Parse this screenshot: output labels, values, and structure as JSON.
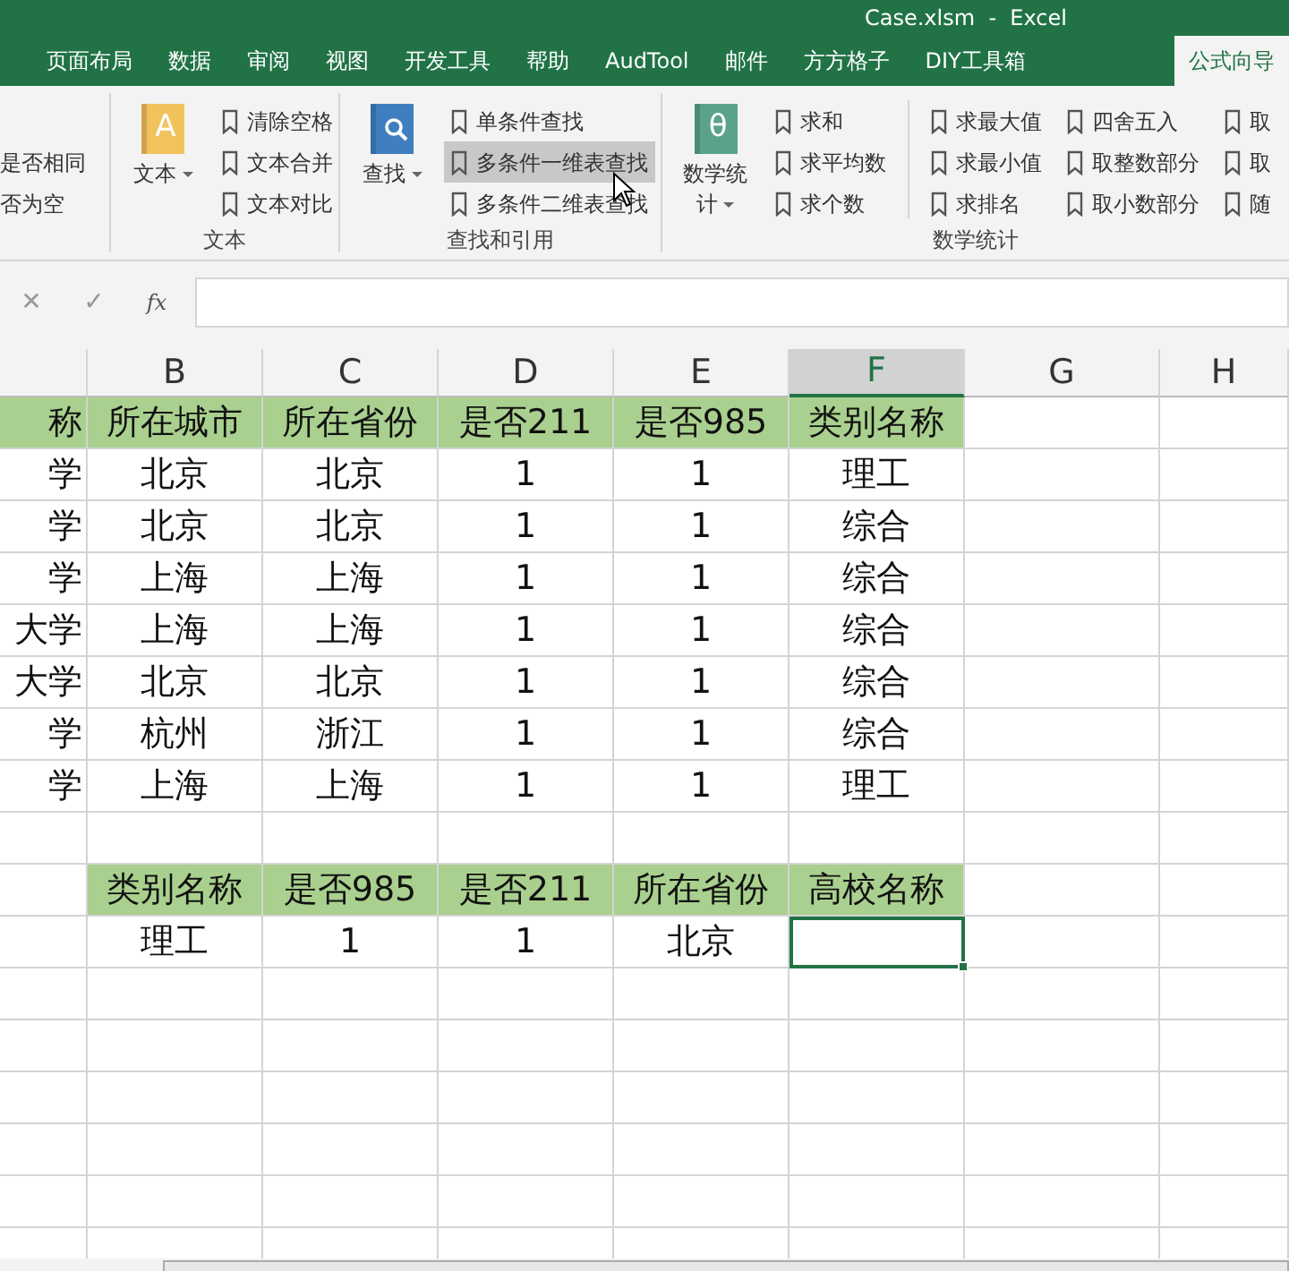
{
  "window": {
    "title": "Case.xlsm  -  Excel"
  },
  "tabs": [
    {
      "label": "页面布局",
      "selected": false
    },
    {
      "label": "数据",
      "selected": false
    },
    {
      "label": "审阅",
      "selected": false
    },
    {
      "label": "视图",
      "selected": false
    },
    {
      "label": "开发工具",
      "selected": false
    },
    {
      "label": "帮助",
      "selected": false
    },
    {
      "label": "AudTool",
      "selected": false
    },
    {
      "label": "邮件",
      "selected": false
    },
    {
      "label": "方方格子",
      "selected": false
    },
    {
      "label": "DIY工具箱",
      "selected": false
    },
    {
      "label": "公式向导",
      "selected": true
    }
  ],
  "ribbon": {
    "groups": [
      {
        "columns": [
          {
            "kind": "plain",
            "items": [
              {
                "label": "是否相同",
                "highlighted": false
              },
              {
                "label": "否为空",
                "highlighted": false
              }
            ]
          }
        ]
      },
      {
        "label": "文本",
        "big_button": {
          "kind": "letter",
          "glyph": "A",
          "label": "文本"
        },
        "columns": [
          {
            "kind": "bookmark",
            "items": [
              {
                "label": "清除空格",
                "highlighted": false
              },
              {
                "label": "文本合并",
                "highlighted": false
              },
              {
                "label": "文本对比",
                "highlighted": false
              }
            ]
          }
        ]
      },
      {
        "label": "查找和引用",
        "big_button": {
          "kind": "search",
          "label": "查找"
        },
        "columns": [
          {
            "kind": "bookmark",
            "items": [
              {
                "label": "单条件查找",
                "highlighted": false
              },
              {
                "label": "多条件一维表查找",
                "highlighted": true
              },
              {
                "label": "多条件二维表查找",
                "highlighted": false
              }
            ]
          }
        ]
      },
      {
        "label": "数学统计",
        "big_button": {
          "kind": "letter",
          "glyph": "θ",
          "label": "数学统计"
        },
        "columns": [
          {
            "kind": "bookmark",
            "items": [
              {
                "label": "求和",
                "highlighted": false
              },
              {
                "label": "求平均数",
                "highlighted": false
              },
              {
                "label": "求个数",
                "highlighted": false
              }
            ]
          },
          {
            "kind": "separator"
          },
          {
            "kind": "bookmark",
            "items": [
              {
                "label": "求最大值",
                "highlighted": false
              },
              {
                "label": "求最小值",
                "highlighted": false
              },
              {
                "label": "求排名",
                "highlighted": false
              }
            ]
          },
          {
            "kind": "bookmark",
            "items": [
              {
                "label": "四舍五入",
                "highlighted": false
              },
              {
                "label": "取整数部分",
                "highlighted": false
              },
              {
                "label": "取小数部分",
                "highlighted": false
              }
            ]
          },
          {
            "kind": "bookmark",
            "items": [
              {
                "label": "取",
                "highlighted": false
              },
              {
                "label": "取",
                "highlighted": false
              },
              {
                "label": "随",
                "highlighted": false
              }
            ]
          }
        ]
      }
    ]
  },
  "formula_bar": {
    "cancel": "✕",
    "enter": "✓",
    "function_label": "fx"
  },
  "sheet": {
    "columns": [
      null,
      {
        "label": "B",
        "selected": false
      },
      {
        "label": "C",
        "selected": false
      },
      {
        "label": "D",
        "selected": false
      },
      {
        "label": "E",
        "selected": false
      },
      {
        "label": "F",
        "selected": true
      },
      {
        "label": "G",
        "selected": false
      },
      {
        "label": "H",
        "selected": false
      }
    ],
    "rows": [
      {
        "kind": "header",
        "cells": [
          {
            "text": "称"
          },
          {
            "text": "所在城市"
          },
          {
            "text": "所在省份"
          },
          {
            "text": "是否211"
          },
          {
            "text": "是否985"
          },
          {
            "text": "类别名称"
          },
          null,
          null
        ]
      },
      {
        "kind": "data",
        "cells": [
          {
            "text": "学"
          },
          {
            "text": "北京"
          },
          {
            "text": "北京"
          },
          {
            "text": "1"
          },
          {
            "text": "1"
          },
          {
            "text": "理工"
          },
          null,
          null
        ]
      },
      {
        "kind": "data",
        "cells": [
          {
            "text": "学"
          },
          {
            "text": "北京"
          },
          {
            "text": "北京"
          },
          {
            "text": "1"
          },
          {
            "text": "1"
          },
          {
            "text": "综合"
          },
          null,
          null
        ]
      },
      {
        "kind": "data",
        "cells": [
          {
            "text": "学"
          },
          {
            "text": "上海"
          },
          {
            "text": "上海"
          },
          {
            "text": "1"
          },
          {
            "text": "1"
          },
          {
            "text": "综合"
          },
          null,
          null
        ]
      },
      {
        "kind": "data",
        "cells": [
          {
            "text": "大学"
          },
          {
            "text": "上海"
          },
          {
            "text": "上海"
          },
          {
            "text": "1"
          },
          {
            "text": "1"
          },
          {
            "text": "综合"
          },
          null,
          null
        ]
      },
      {
        "kind": "data",
        "cells": [
          {
            "text": "大学"
          },
          {
            "text": "北京"
          },
          {
            "text": "北京"
          },
          {
            "text": "1"
          },
          {
            "text": "1"
          },
          {
            "text": "综合"
          },
          null,
          null
        ]
      },
      {
        "kind": "data",
        "cells": [
          {
            "text": "学"
          },
          {
            "text": "杭州"
          },
          {
            "text": "浙江"
          },
          {
            "text": "1"
          },
          {
            "text": "1"
          },
          {
            "text": "综合"
          },
          null,
          null
        ]
      },
      {
        "kind": "data",
        "cells": [
          {
            "text": "学"
          },
          {
            "text": "上海"
          },
          {
            "text": "上海"
          },
          {
            "text": "1"
          },
          {
            "text": "1"
          },
          {
            "text": "理工"
          },
          null,
          null
        ]
      },
      {
        "cells": [
          null,
          null,
          null,
          null,
          null,
          null,
          null,
          null
        ]
      },
      {
        "kind": "header",
        "cells": [
          null,
          {
            "text": "类别名称"
          },
          {
            "text": "是否985"
          },
          {
            "text": "是否211"
          },
          {
            "text": "所在省份"
          },
          {
            "text": "高校名称"
          },
          null,
          null
        ]
      },
      {
        "kind": "data",
        "cells": [
          null,
          {
            "text": "理工"
          },
          {
            "text": "1"
          },
          {
            "text": "1"
          },
          {
            "text": "北京"
          },
          {
            "selected": true
          },
          null,
          null
        ]
      }
    ]
  }
}
